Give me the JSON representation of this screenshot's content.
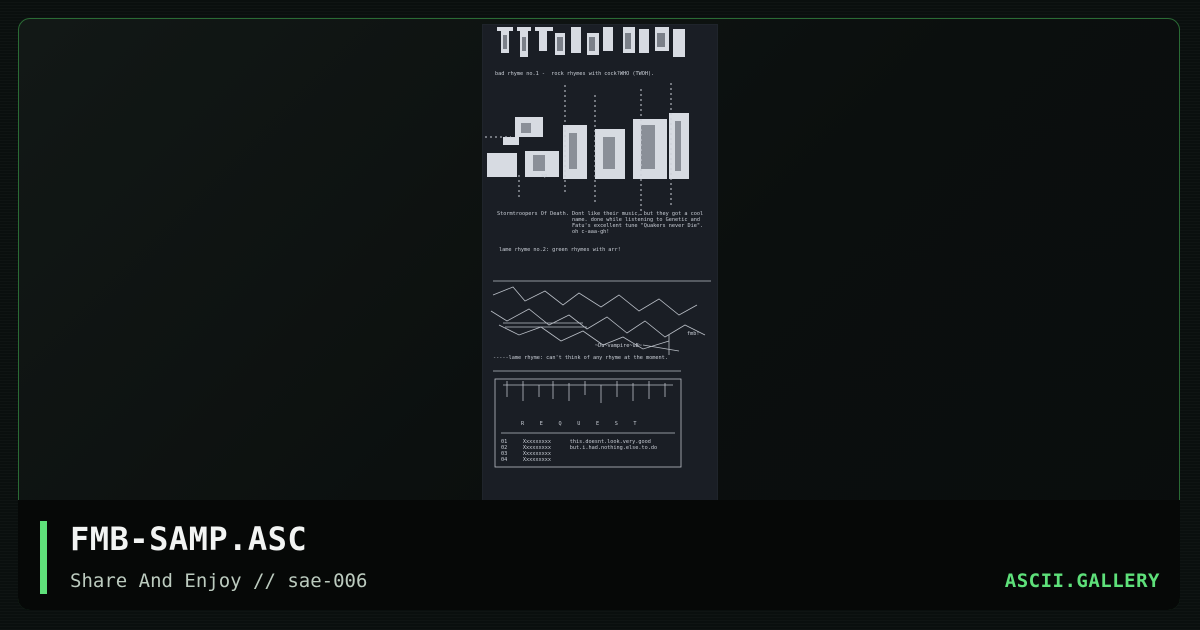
{
  "title": "FMB-SAMP.ASC",
  "subtitle": "Share And Enjoy // sae-006",
  "brand": "ASCII.GALLERY",
  "artwork": {
    "lines": {
      "l1": "bad rhyme no.1 -  rock rhymes with cock?WHO (TWOH).",
      "l2": "Stormtroopers Of Death. Dont like their music, but they got a cool",
      "l3": "                        name. done while listening to Genetic and",
      "l4": "                        Fatu's excellent tune \"Quakers never Die\".",
      "l5": "                        oh c-aaa-gh!",
      "l6": "lame rhyme no.2: green rhymes with arr!",
      "l7": "~Du~vampire~uB~",
      "l8": "-----lame rhyme: can't think of any rhyme at the moment.",
      "l9": "R     E     Q     U     E     S     T",
      "row1": "01     Xxxxxxxxx      this.doesnt.look.very.good",
      "row2": "02     Xxxxxxxxx      but.i.had.nothing.else.to.do",
      "row3": "03     Xxxxxxxxx",
      "row4": "04     Xxxxxxxxx",
      "tag1": "sp",
      "tag2": "fmb!"
    }
  },
  "colors": {
    "accent": "#5ee07a",
    "frame_border": "#2a6b35",
    "background": "#0a0f0e",
    "art_background": "#1a1e25"
  }
}
